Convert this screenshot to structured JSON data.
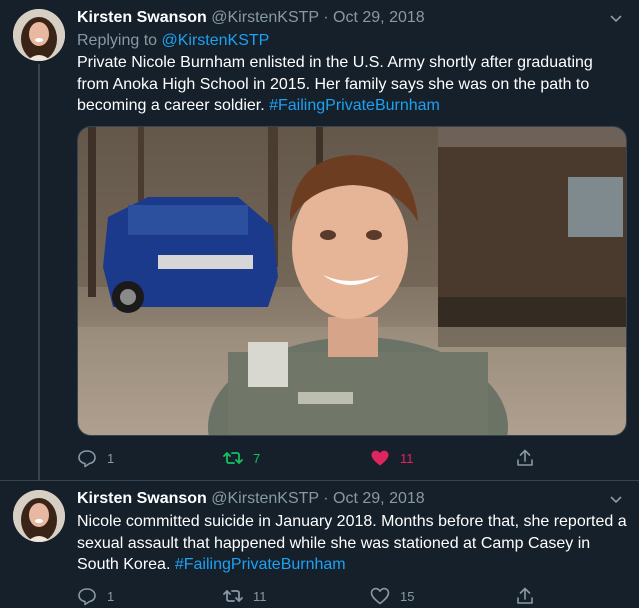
{
  "colors": {
    "background": "#15202b",
    "accent": "#1da1f2",
    "muted": "#8899a6",
    "retweet_active": "#17bf63",
    "like_active": "#e0245e"
  },
  "tweets": [
    {
      "author_name": "Kirsten Swanson",
      "author_handle": "@KirstenKSTP",
      "separator": "·",
      "date": "Oct 29, 2018",
      "reply_prefix": "Replying to",
      "reply_handle": "@KirstenKSTP",
      "text": "Private Nicole Burnham enlisted in the U.S. Army shortly after graduating from Anoka High School in 2015. Her family says she was on the path to becoming a career soldier.",
      "hashtag": "#FailingPrivateBurnham",
      "replies": "1",
      "retweets": "7",
      "likes": "11",
      "retweeted": true,
      "liked": true
    },
    {
      "author_name": "Kirsten Swanson",
      "author_handle": "@KirstenKSTP",
      "separator": "·",
      "date": "Oct 29, 2018",
      "text": "Nicole committed suicide in January 2018. Months before that, she reported a sexual assault that happened while she was stationed at Camp Casey in South Korea.",
      "hashtag": "#FailingPrivateBurnham",
      "replies": "1",
      "retweets": "11",
      "likes": "15",
      "retweeted": false,
      "liked": false
    }
  ],
  "icons": {
    "reply": "reply-icon",
    "retweet": "retweet-icon",
    "like": "heart-icon",
    "share": "share-icon",
    "menu": "chevron-down-icon"
  }
}
